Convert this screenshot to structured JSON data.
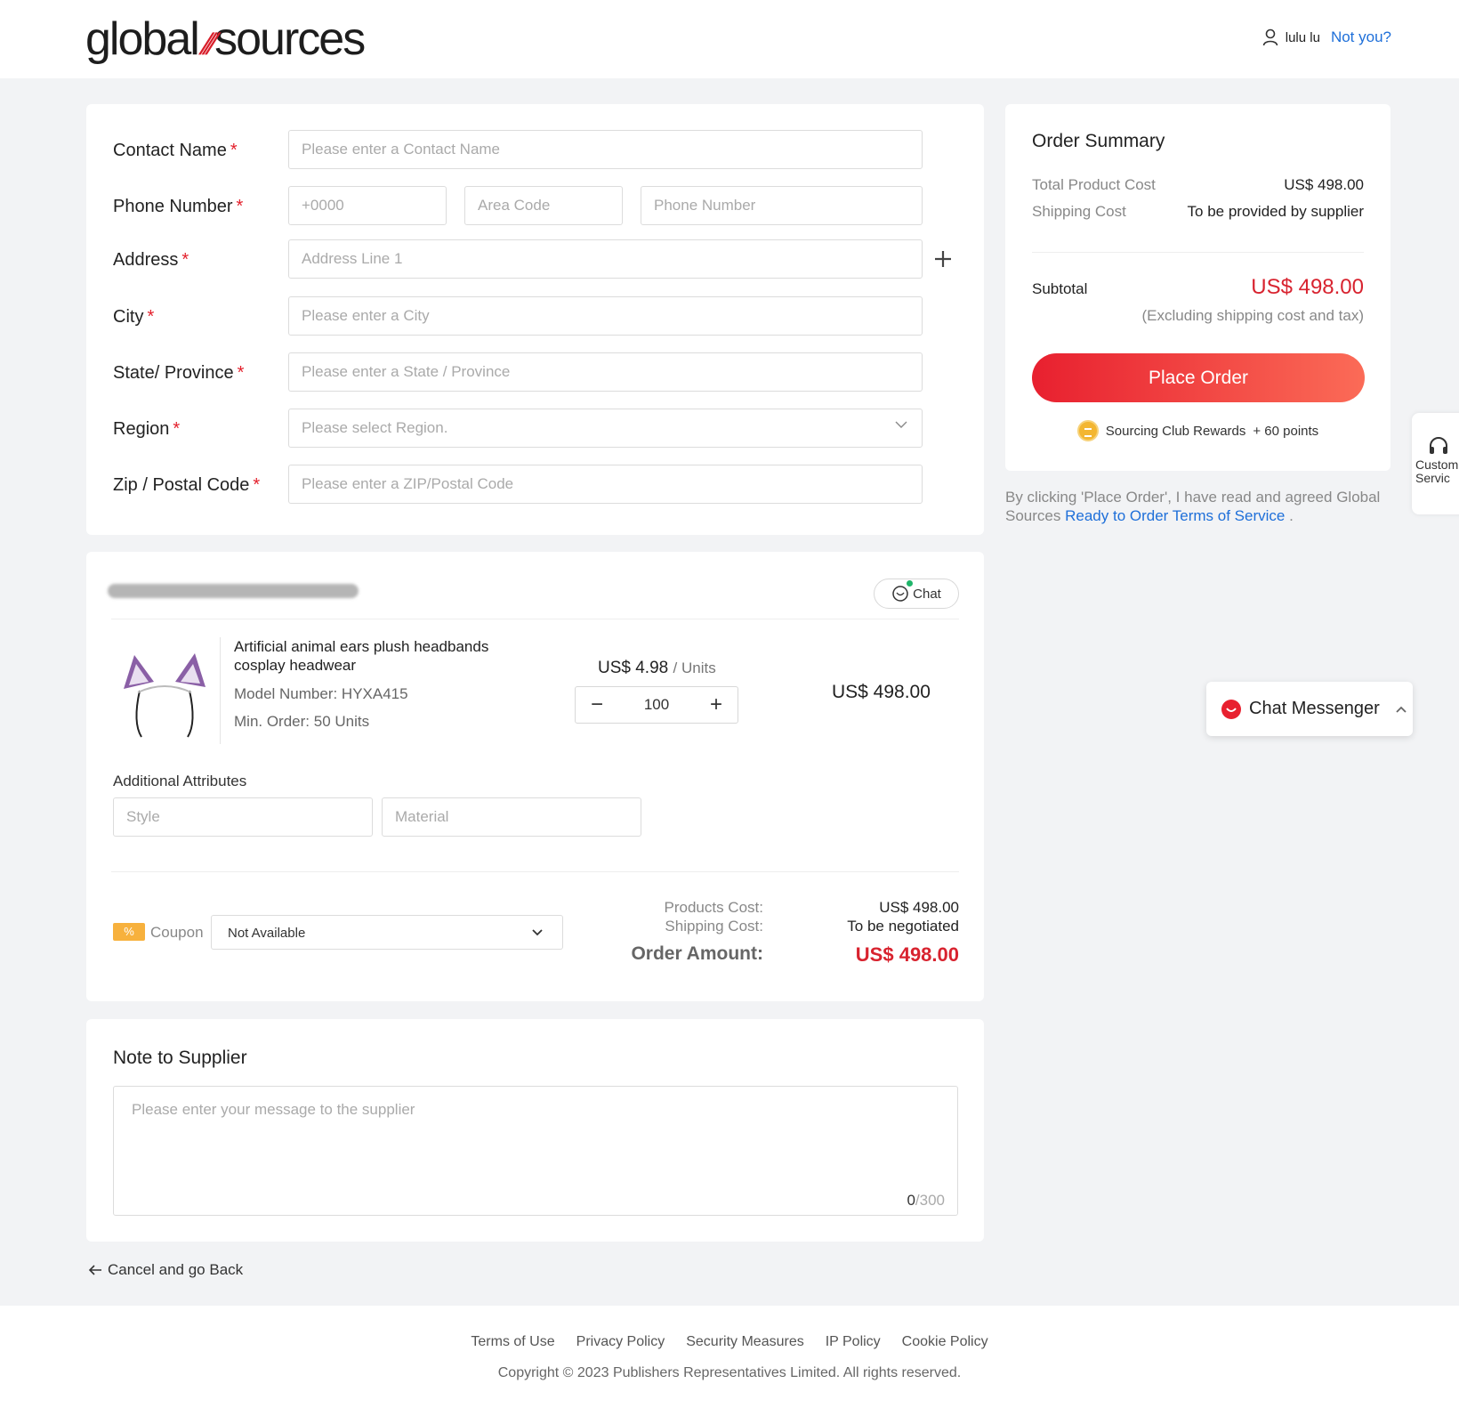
{
  "header": {
    "logo_left": "global",
    "logo_right": "sources",
    "user_name": "lulu lu",
    "not_you": "Not you?"
  },
  "form": {
    "contact_name": {
      "label": "Contact Name",
      "placeholder": "Please enter a Contact Name"
    },
    "phone": {
      "label": "Phone Number",
      "country_placeholder": "+0000",
      "area_placeholder": "Area Code",
      "number_placeholder": "Phone Number"
    },
    "address": {
      "label": "Address",
      "placeholder": "Address Line 1"
    },
    "city": {
      "label": "City",
      "placeholder": "Please enter a City"
    },
    "state": {
      "label": "State/ Province",
      "placeholder": "Please enter a State / Province"
    },
    "region": {
      "label": "Region",
      "placeholder": "Please select Region."
    },
    "zip": {
      "label": "Zip / Postal Code",
      "placeholder": "Please enter a ZIP/Postal Code"
    },
    "required_mark": "*"
  },
  "order": {
    "chat_label": "Chat",
    "product": {
      "name": "Artificial animal ears plush headbands cosplay headwear",
      "model": "Model Number: HYXA415",
      "min_order": "Min. Order: 50 Units",
      "unit_price": "US$ 4.98",
      "unit_suffix": "/ Units",
      "quantity": "100",
      "line_total": "US$ 498.00"
    },
    "additional_attributes": "Additional Attributes",
    "style_placeholder": "Style",
    "material_placeholder": "Material",
    "coupon_badge": "%",
    "coupon_label": "Coupon",
    "coupon_value": "Not Available",
    "products_cost_label": "Products Cost:",
    "products_cost_value": "US$ 498.00",
    "shipping_cost_label": "Shipping Cost:",
    "shipping_cost_value": "To be negotiated",
    "order_amount_label": "Order Amount:",
    "order_amount_value": "US$ 498.00"
  },
  "note": {
    "title": "Note to Supplier",
    "placeholder": "Please enter your message to the supplier",
    "count_current": "0",
    "count_max": "/300"
  },
  "cancel_link": "Cancel and go Back",
  "summary": {
    "title": "Order Summary",
    "total_product_cost_label": "Total Product Cost",
    "total_product_cost_value": "US$ 498.00",
    "shipping_cost_label": "Shipping Cost",
    "shipping_cost_value": "To be provided by supplier",
    "subtotal_label": "Subtotal",
    "subtotal_value": "US$ 498.00",
    "subtotal_note": "(Excluding shipping cost and tax)",
    "place_order": "Place Order",
    "rewards_label": "Sourcing Club Rewards",
    "rewards_points": "+ 60 points",
    "agree_text": "By clicking 'Place Order', I have read and agreed Global Sources",
    "agree_link": "Ready to Order Terms of Service",
    "agree_end": "."
  },
  "customer_service": "Custom Servic",
  "chat_messenger": "Chat Messenger",
  "footer": {
    "links": [
      "Terms of Use",
      "Privacy Policy",
      "Security Measures",
      "IP Policy",
      "Cookie Policy"
    ],
    "copyright": "Copyright © 2023 Publishers Representatives Limited. All rights reserved."
  },
  "colors": {
    "accent_red": "#d8232f",
    "link_blue": "#1e6fd9",
    "coupon_orange": "#f7b13d"
  }
}
